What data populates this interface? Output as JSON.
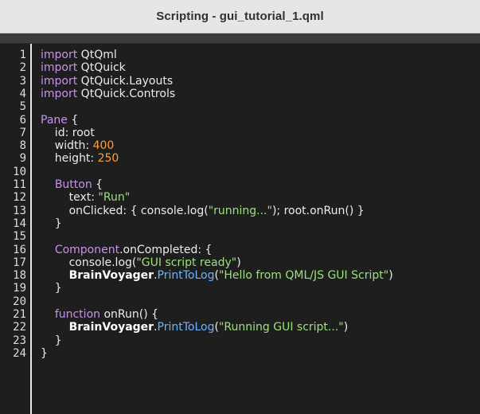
{
  "window": {
    "title": "Scripting - gui_tutorial_1.qml"
  },
  "editor": {
    "lines": [
      {
        "n": "1",
        "tokens": [
          {
            "t": "import",
            "c": "kw"
          },
          {
            "t": " QtQml",
            "c": "plain"
          }
        ]
      },
      {
        "n": "2",
        "tokens": [
          {
            "t": "import",
            "c": "kw"
          },
          {
            "t": " QtQuick",
            "c": "plain"
          }
        ]
      },
      {
        "n": "3",
        "tokens": [
          {
            "t": "import",
            "c": "kw"
          },
          {
            "t": " QtQuick.Layouts",
            "c": "plain"
          }
        ]
      },
      {
        "n": "4",
        "tokens": [
          {
            "t": "import",
            "c": "kw"
          },
          {
            "t": " QtQuick.Controls",
            "c": "plain"
          }
        ]
      },
      {
        "n": "5",
        "tokens": []
      },
      {
        "n": "6",
        "tokens": [
          {
            "t": "Pane",
            "c": "kw"
          },
          {
            "t": " {",
            "c": "plain"
          }
        ]
      },
      {
        "n": "7",
        "tokens": [
          {
            "t": "    id: root",
            "c": "plain"
          }
        ]
      },
      {
        "n": "8",
        "tokens": [
          {
            "t": "    width: ",
            "c": "plain"
          },
          {
            "t": "400",
            "c": "num"
          }
        ]
      },
      {
        "n": "9",
        "tokens": [
          {
            "t": "    height: ",
            "c": "plain"
          },
          {
            "t": "250",
            "c": "num"
          }
        ]
      },
      {
        "n": "10",
        "tokens": []
      },
      {
        "n": "11",
        "tokens": [
          {
            "t": "    ",
            "c": "plain"
          },
          {
            "t": "Button",
            "c": "kw"
          },
          {
            "t": " {",
            "c": "plain"
          }
        ]
      },
      {
        "n": "12",
        "tokens": [
          {
            "t": "        text: ",
            "c": "plain"
          },
          {
            "t": "\"Run\"",
            "c": "str"
          }
        ]
      },
      {
        "n": "13",
        "tokens": [
          {
            "t": "        onClicked: { console.log(",
            "c": "plain"
          },
          {
            "t": "\"running...\"",
            "c": "str"
          },
          {
            "t": "); root.onRun() }",
            "c": "plain"
          }
        ]
      },
      {
        "n": "14",
        "tokens": [
          {
            "t": "    }",
            "c": "plain"
          }
        ]
      },
      {
        "n": "15",
        "tokens": []
      },
      {
        "n": "16",
        "tokens": [
          {
            "t": "    ",
            "c": "plain"
          },
          {
            "t": "Component",
            "c": "kw"
          },
          {
            "t": ".onCompleted: {",
            "c": "plain"
          }
        ]
      },
      {
        "n": "17",
        "tokens": [
          {
            "t": "        console.log(",
            "c": "plain"
          },
          {
            "t": "\"GUI script ready\"",
            "c": "str"
          },
          {
            "t": ")",
            "c": "plain"
          }
        ]
      },
      {
        "n": "18",
        "tokens": [
          {
            "t": "        ",
            "c": "plain"
          },
          {
            "t": "BrainVoyager",
            "c": "obj"
          },
          {
            "t": ".",
            "c": "plain"
          },
          {
            "t": "PrintToLog",
            "c": "fn"
          },
          {
            "t": "(",
            "c": "plain"
          },
          {
            "t": "\"Hello from QML/JS GUI Script\"",
            "c": "str"
          },
          {
            "t": ")",
            "c": "plain"
          }
        ]
      },
      {
        "n": "19",
        "tokens": [
          {
            "t": "    }",
            "c": "plain"
          }
        ]
      },
      {
        "n": "20",
        "tokens": []
      },
      {
        "n": "21",
        "tokens": [
          {
            "t": "    ",
            "c": "plain"
          },
          {
            "t": "function",
            "c": "kw"
          },
          {
            "t": " onRun() {",
            "c": "plain"
          }
        ]
      },
      {
        "n": "22",
        "tokens": [
          {
            "t": "        ",
            "c": "plain"
          },
          {
            "t": "BrainVoyager",
            "c": "obj"
          },
          {
            "t": ".",
            "c": "plain"
          },
          {
            "t": "PrintToLog",
            "c": "fn"
          },
          {
            "t": "(",
            "c": "plain"
          },
          {
            "t": "\"Running GUI script...\"",
            "c": "str"
          },
          {
            "t": ")",
            "c": "plain"
          }
        ]
      },
      {
        "n": "23",
        "tokens": [
          {
            "t": "    }",
            "c": "plain"
          }
        ]
      },
      {
        "n": "24",
        "tokens": [
          {
            "t": "}",
            "c": "plain"
          }
        ]
      }
    ]
  }
}
